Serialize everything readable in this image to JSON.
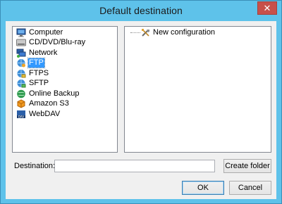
{
  "window": {
    "title": "Default destination",
    "close_glyph": "✕"
  },
  "sources": [
    {
      "label": "Computer",
      "icon": "computer-icon"
    },
    {
      "label": "CD/DVD/Blu-ray",
      "icon": "disc-icon"
    },
    {
      "label": "Network",
      "icon": "network-icon"
    },
    {
      "label": "FTP",
      "icon": "ftp-icon",
      "selected": true
    },
    {
      "label": "FTPS",
      "icon": "ftps-icon"
    },
    {
      "label": "SFTP",
      "icon": "sftp-icon"
    },
    {
      "label": "Online Backup",
      "icon": "globe-icon"
    },
    {
      "label": "Amazon S3",
      "icon": "amazon-s3-icon"
    },
    {
      "label": "WebDAV",
      "icon": "webdav-icon"
    }
  ],
  "tree": {
    "node_label": "New configuration",
    "node_icon": "tools-icon"
  },
  "destination": {
    "label": "Destination:",
    "value": ""
  },
  "buttons": {
    "create_folder": "Create folder",
    "ok": "OK",
    "cancel": "Cancel"
  },
  "colors": {
    "selection": "#3399ff",
    "frame": "#5ec2ea",
    "close": "#c7504a"
  }
}
